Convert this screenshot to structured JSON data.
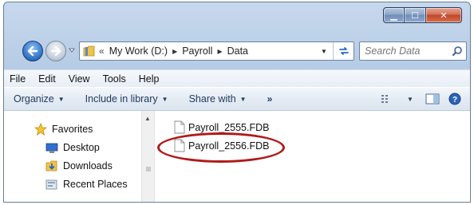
{
  "window": {
    "caption_buttons": {
      "minimize": "▁",
      "maximize": "☐",
      "close": "✕"
    }
  },
  "navbar": {
    "overflow": "«",
    "breadcrumb": [
      "My Work (D:)",
      "Payroll",
      "Data"
    ],
    "separator": "▶",
    "dropdown": "▼",
    "search_placeholder": "Search Data"
  },
  "menu": {
    "items": [
      "File",
      "Edit",
      "View",
      "Tools",
      "Help"
    ]
  },
  "toolbar": {
    "organize": "Organize",
    "include_in_library": "Include in library",
    "share_with": "Share with",
    "more": "»",
    "caret": "▼"
  },
  "nav_pane": {
    "favorites": "Favorites",
    "items": [
      "Desktop",
      "Downloads",
      "Recent Places"
    ],
    "scroll_up": "▲"
  },
  "files": [
    {
      "name": "Payroll_2555.FDB"
    },
    {
      "name": "Payroll_2556.FDB",
      "highlighted": true
    }
  ],
  "colors": {
    "highlight": "#b01a1a",
    "accent": "#3d7fd1",
    "toolbar_text": "#1e395b"
  },
  "icons": {
    "back": "back-arrow-icon",
    "forward": "forward-arrow-icon",
    "folder": "folder-icon",
    "refresh": "refresh-icon",
    "search": "search-icon",
    "views": "views-icon",
    "preview": "preview-pane-icon",
    "help": "help-icon",
    "favorites": "star-icon",
    "desktop": "desktop-icon",
    "downloads": "downloads-icon",
    "recent": "recent-places-icon",
    "file": "file-icon"
  }
}
